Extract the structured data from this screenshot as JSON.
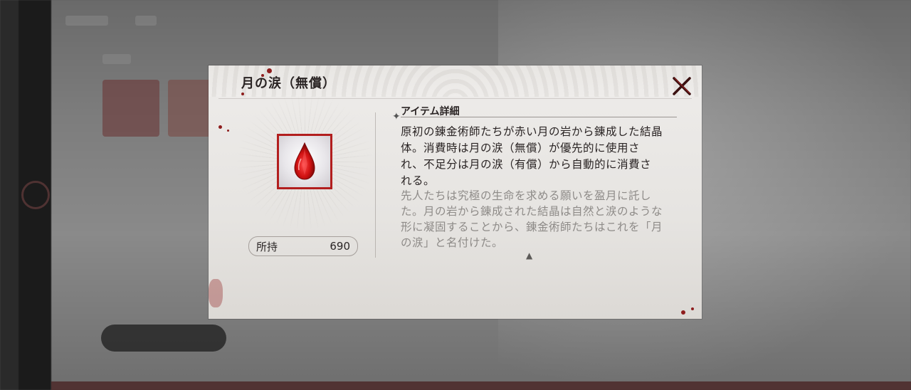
{
  "dialog": {
    "title": "月の涙（無償）",
    "section_title": "アイテム詳細",
    "description": "原初の錬金術師たちが赤い月の岩から錬成した結晶体。消費時は月の涙（無償）が優先的に使用され、不足分は月の涙（有償）から自動的に消費される。",
    "lore": "先人たちは究極の生命を求める願いを盈月に託した。月の岩から錬成された結晶は自然と涙のような形に凝固することから、錬金術師たちはこれを「月の涙」と名付けた。",
    "owned_label": "所持",
    "owned_value": "690",
    "close_icon": "close-x-icon",
    "item_icon": "blood-drop-gem-icon",
    "scroll_icon": "arrow-up-icon"
  },
  "colors": {
    "accent": "#b21e1e",
    "text": "#2a2424",
    "lore_text": "#8e8b88",
    "panel": "#e9e7e4"
  }
}
